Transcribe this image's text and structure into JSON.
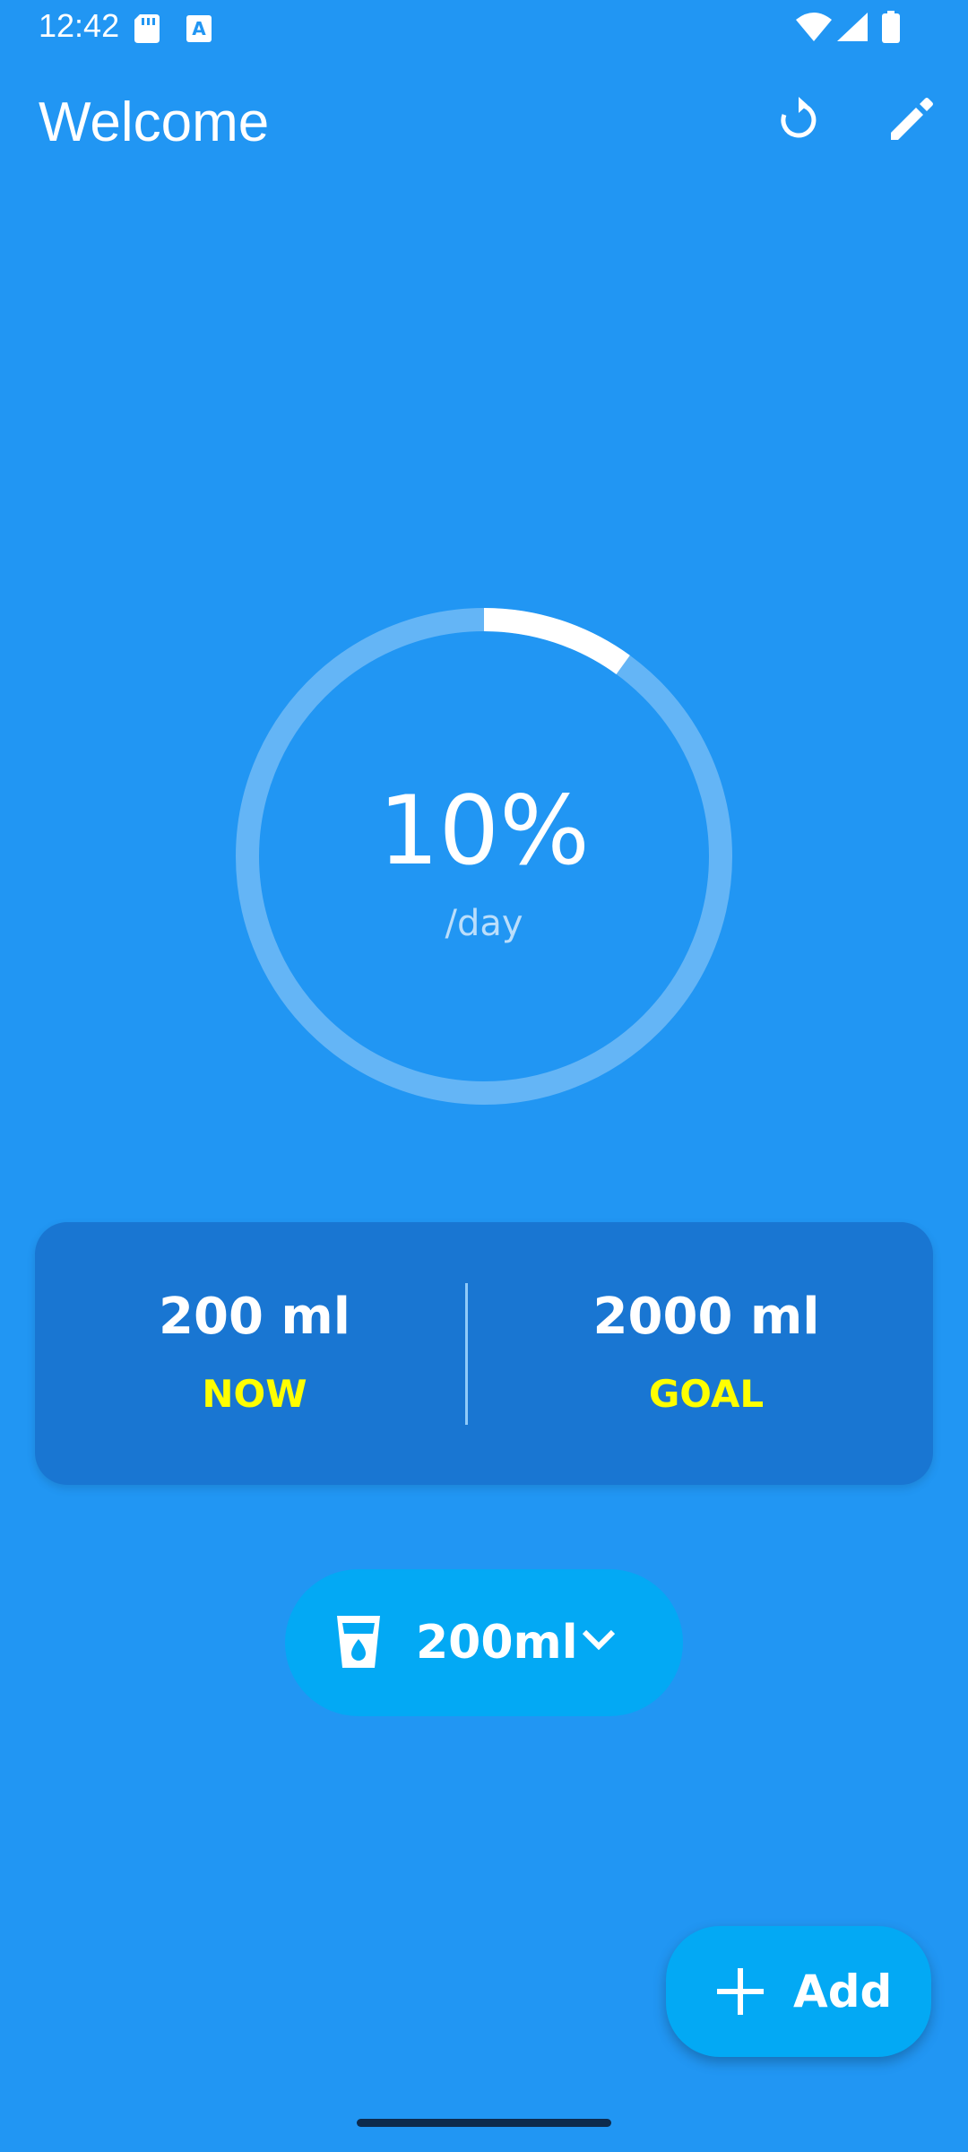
{
  "status_bar": {
    "time": "12:42",
    "left_icons": [
      "sd-card-icon",
      "accessibility-a-icon"
    ],
    "right_icons": [
      "wifi-icon",
      "signal-icon",
      "battery-icon"
    ]
  },
  "app_bar": {
    "title": "Welcome",
    "actions": [
      "refresh-icon",
      "edit-pencil-icon"
    ]
  },
  "progress": {
    "percent_text": "10%",
    "fraction": 0.1,
    "subtitle": "/day"
  },
  "stats": {
    "now_value": "200 ml",
    "now_label": "NOW",
    "goal_value": "2000 ml",
    "goal_label": "GOAL"
  },
  "cup_selector": {
    "value": "200ml",
    "icon": "cup-water-icon",
    "chevron": "chevron-down-icon"
  },
  "fab": {
    "label": "Add",
    "icon": "plus-icon"
  },
  "colors": {
    "background": "#2196F3",
    "card": "#1976D2",
    "accent": "#03A9F4",
    "label_yellow": "#FFFF00",
    "ring_track": "#64B5F6",
    "ring_progress": "#FFFFFF"
  }
}
